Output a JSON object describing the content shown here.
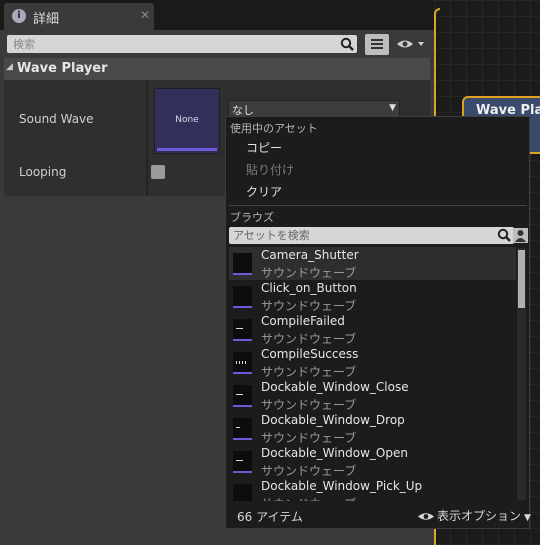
{
  "tab": {
    "title": "詳細",
    "icon": "info-icon"
  },
  "details": {
    "search_placeholder": "検索",
    "category": "Wave Player",
    "properties": {
      "sound_wave_label": "Sound Wave",
      "thumbnail_text": "None",
      "combo_value": "なし",
      "looping_label": "Looping",
      "looping_checked": false
    }
  },
  "graph": {
    "node_title": "Wave Player"
  },
  "menu": {
    "in_use_header": "使用中のアセット",
    "copy": "コピー",
    "paste": "貼り付け",
    "clear": "クリア",
    "browse_header": "ブラウズ",
    "asset_search_placeholder": "アセットを検索",
    "assets": [
      {
        "name": "Camera_Shutter",
        "type": "サウンドウェーブ"
      },
      {
        "name": "Click_on_Button",
        "type": "サウンドウェーブ"
      },
      {
        "name": "CompileFailed",
        "type": "サウンドウェーブ"
      },
      {
        "name": "CompileSuccess",
        "type": "サウンドウェーブ"
      },
      {
        "name": "Dockable_Window_Close",
        "type": "サウンドウェーブ"
      },
      {
        "name": "Dockable_Window_Drop",
        "type": "サウンドウェーブ"
      },
      {
        "name": "Dockable_Window_Open",
        "type": "サウンドウェーブ"
      },
      {
        "name": "Dockable_Window_Pick_Up",
        "type": "サウンドウェーブ"
      }
    ],
    "item_count": "66 アイテム",
    "view_options": "表示オプション"
  },
  "colors": {
    "accent": "#6e5ad6",
    "graph_border": "#d8a82a"
  }
}
